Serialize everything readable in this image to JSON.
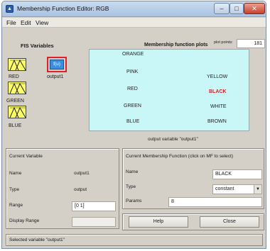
{
  "window": {
    "title": "Membership Function Editor: RGB"
  },
  "menu": {
    "items": [
      "File",
      "Edit",
      "View"
    ]
  },
  "fis": {
    "label": "FIS Variables",
    "inputs": [
      {
        "label": "RED"
      },
      {
        "label": "GREEN"
      },
      {
        "label": "BLUE"
      }
    ],
    "output": {
      "box_text": "f(u)",
      "label": "output1"
    }
  },
  "plot": {
    "title": "Membership function plots",
    "points_label": "plot points:",
    "points_value": "181",
    "mf_labels_left": [
      "ORANGE",
      "PINK",
      "RED",
      "GREEN",
      "BLUE"
    ],
    "mf_labels_right": [
      "YELLOW",
      "BLACK",
      "WHITE",
      "BROWN"
    ],
    "selected_mf": "BLACK",
    "caption": "output variable \"output1\""
  },
  "current_variable": {
    "header": "Current Variable",
    "name_label": "Name",
    "name_value": "output1",
    "type_label": "Type",
    "type_value": "output",
    "range_label": "Range",
    "range_value": "[0 1]",
    "display_range_label": "Display Range",
    "display_range_value": ""
  },
  "current_mf": {
    "header": "Current Membership Function (click on MF to select)",
    "name_label": "Name",
    "name_value": "BLACK",
    "type_label": "Type",
    "type_value": "constant",
    "params_label": "Params",
    "params_value": "8"
  },
  "buttons": {
    "help": "Help",
    "close": "Close"
  },
  "status": {
    "text": "Selected variable \"output1\""
  },
  "colors": {
    "input_box": "#ffff66",
    "output_box": "#3b8fe0",
    "selection_border": "#e0202a",
    "plot_background": "#c9f6f7"
  }
}
